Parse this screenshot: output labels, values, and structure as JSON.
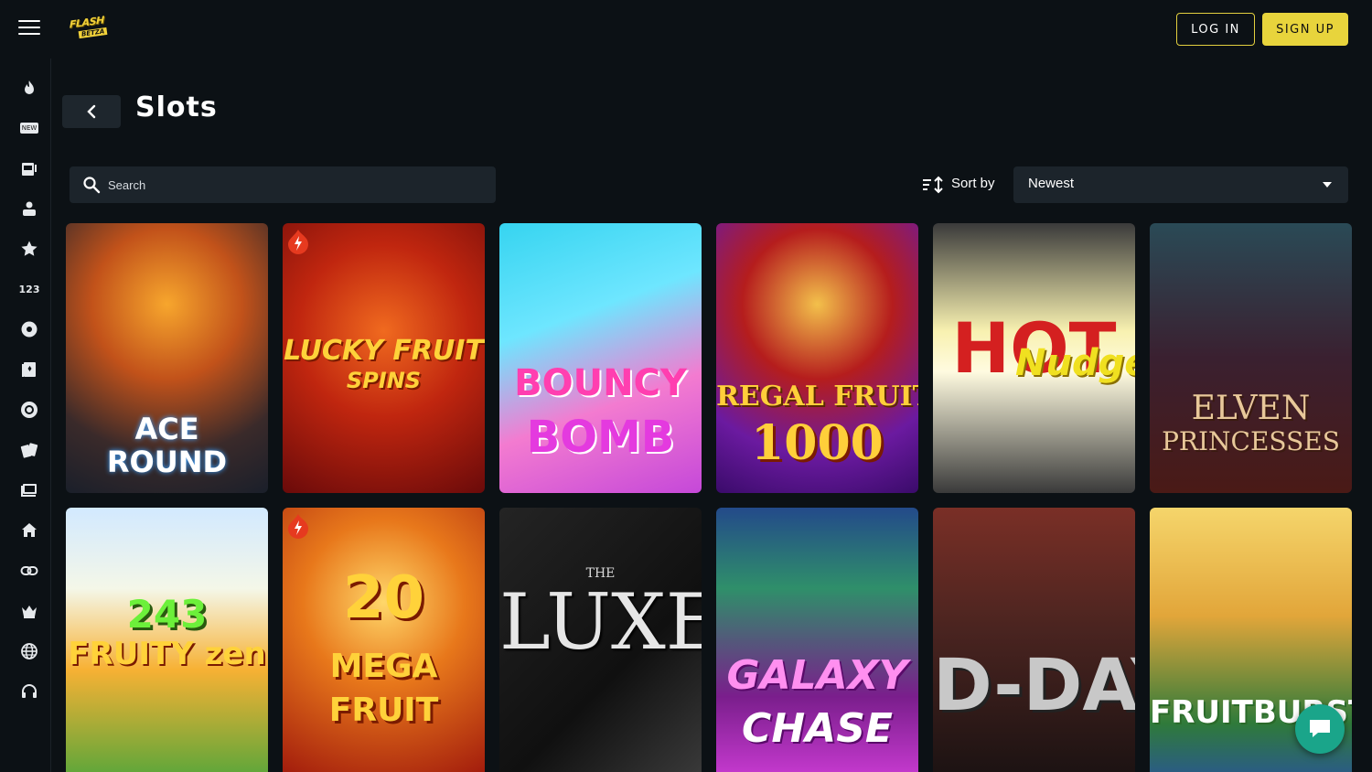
{
  "header": {
    "logo_top": "FLASH",
    "logo_bottom": "BETZA",
    "login_label": "LOG IN",
    "signup_label": "SIGN UP"
  },
  "sidebar": {
    "items": [
      {
        "icon": "fire-icon"
      },
      {
        "icon": "new-badge-icon",
        "text": "NEW"
      },
      {
        "icon": "slot-machine-icon"
      },
      {
        "icon": "live-dealer-icon"
      },
      {
        "icon": "star-icon"
      },
      {
        "icon": "numbers-icon",
        "text": "123"
      },
      {
        "icon": "roulette-icon"
      },
      {
        "icon": "cards-book-icon"
      },
      {
        "icon": "poker-chip-icon"
      },
      {
        "icon": "playing-cards-icon"
      },
      {
        "icon": "tv-game-icon"
      },
      {
        "icon": "home-icon"
      },
      {
        "icon": "link-icon"
      },
      {
        "icon": "crown-icon"
      },
      {
        "icon": "globe-icon"
      },
      {
        "icon": "headset-icon"
      }
    ]
  },
  "page": {
    "title": "Slots"
  },
  "search": {
    "placeholder": "Search"
  },
  "sort": {
    "label": "Sort by",
    "value": "Newest"
  },
  "games": [
    {
      "line1": "ACE",
      "line2": "ROUND",
      "color": "#ffffff"
    },
    {
      "line1": "LUCKY FRUIT",
      "line2": "SPINS",
      "color": "#ffd23a"
    },
    {
      "line1": "BOUNCY",
      "line2": "BOMB",
      "color": "#ff3fb0"
    },
    {
      "line1": "REGAL FRUIT",
      "line2": "1000",
      "color": "#ffcf3a"
    },
    {
      "line1": "HOT",
      "line2": "Nudge",
      "color": "#d42020"
    },
    {
      "line1": "ELVEN",
      "line2": "PRINCESSES",
      "color": "#e8c89a"
    },
    {
      "line1": "243",
      "line2": "FRUITY zen",
      "color": "#6cf03a"
    },
    {
      "line1": "20",
      "line2": "MEGA FRUIT",
      "color": "#ffd23a"
    },
    {
      "line1": "THE",
      "line2": "LUXE",
      "color": "#d9d9d9"
    },
    {
      "line1": "GALAXY",
      "line2": "CHASE",
      "color": "#ff8ff0"
    },
    {
      "line1": "D-DAY",
      "line2": "",
      "color": "#c8c8c8"
    },
    {
      "line1": "FRUITBURST",
      "line2": "",
      "color": "#ffffff"
    }
  ]
}
